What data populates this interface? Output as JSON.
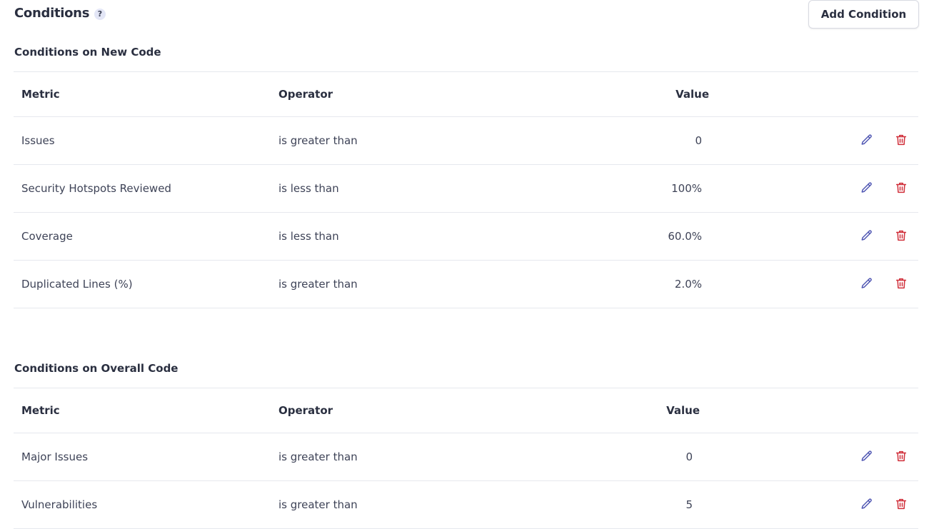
{
  "header": {
    "title": "Conditions",
    "help_glyph": "?",
    "add_button_label": "Add Condition"
  },
  "columns": {
    "metric": "Metric",
    "operator": "Operator",
    "value": "Value"
  },
  "new_code": {
    "title": "Conditions on New Code",
    "rows": [
      {
        "metric": "Issues",
        "operator": "is greater than",
        "value": "0"
      },
      {
        "metric": "Security Hotspots Reviewed",
        "operator": "is less than",
        "value": "100%"
      },
      {
        "metric": "Coverage",
        "operator": "is less than",
        "value": "60.0%"
      },
      {
        "metric": "Duplicated Lines (%)",
        "operator": "is greater than",
        "value": "2.0%"
      }
    ]
  },
  "overall_code": {
    "title": "Conditions on Overall Code",
    "rows": [
      {
        "metric": "Major Issues",
        "operator": "is greater than",
        "value": "0"
      },
      {
        "metric": "Vulnerabilities",
        "operator": "is greater than",
        "value": "5"
      }
    ]
  },
  "icons": {
    "edit": "pencil-icon",
    "delete": "trash-icon",
    "help": "question-mark-icon"
  },
  "colors": {
    "edit_icon": "#5057b3",
    "delete_icon": "#d02f3a",
    "text": "#3e4357",
    "heading": "#2a2f40",
    "divider": "#e6e8ee"
  }
}
